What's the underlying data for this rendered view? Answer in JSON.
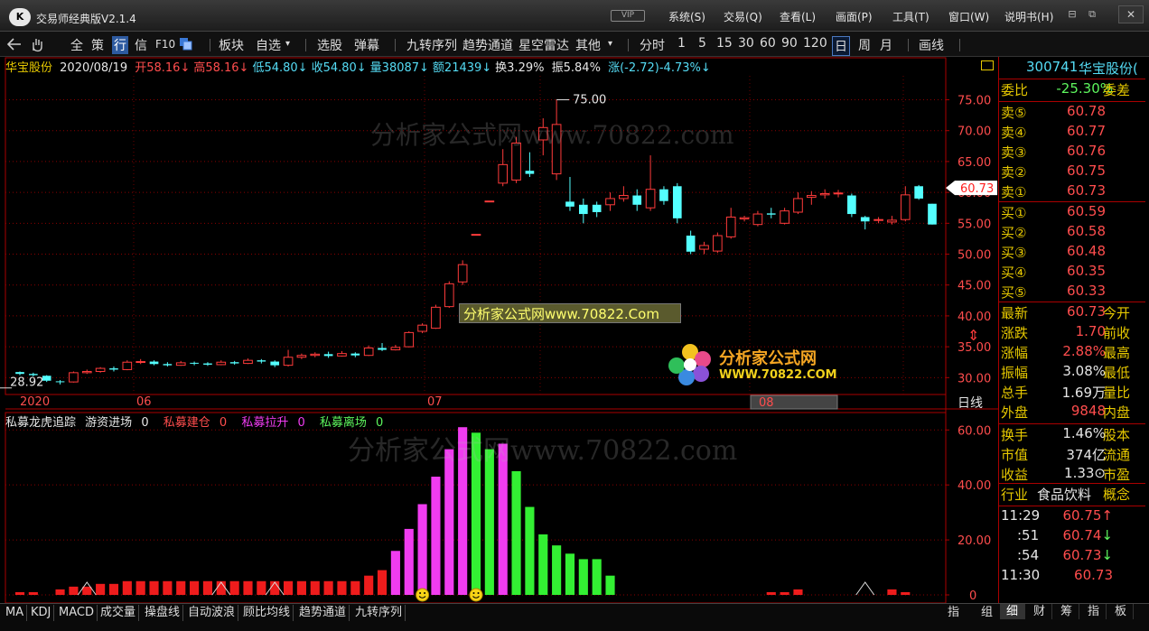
{
  "app": {
    "logo": "K",
    "title": "交易师经典版V2.1.4",
    "vip": "VIP"
  },
  "menu": [
    "系统(S)",
    "交易(Q)",
    "查看(L)",
    "画面(P)",
    "工具(T)",
    "窗口(W)",
    "说明书(H)"
  ],
  "window_controls": {
    "restore": "⊟",
    "max": "⧉",
    "close": "✕"
  },
  "toolbar": {
    "icons": [
      "back-icon",
      "hand-icon"
    ],
    "items": [
      "全",
      "策",
      "行",
      "信",
      "F10",
      "板块",
      "自选",
      "选股",
      "弹幕",
      "九转序列",
      "趋势通道",
      "星空雷达",
      "其他",
      "分时",
      "1",
      "5",
      "15",
      "30",
      "60",
      "90",
      "120",
      "日",
      "周",
      "月",
      "画线"
    ],
    "active": "行",
    "selected_period": "日"
  },
  "info": {
    "name": "华宝股份",
    "date": "2020/08/19",
    "open": "开58.16↓",
    "high": "高58.16↓",
    "low": "低54.80↓",
    "close": "收54.80↓",
    "volume": "量38087↓",
    "amount": "额21439↓",
    "turnover": "换3.29%",
    "amplitude": "振5.84%",
    "change": "涨(-2.72)-4.73%↓"
  },
  "price_axis": {
    "ticks": [
      "75.00",
      "70.00",
      "65.00",
      "60.00",
      "55.00",
      "50.00",
      "45.00",
      "40.00",
      "35.00",
      "30.00"
    ],
    "current": "60.73"
  },
  "annotations": {
    "high_label": "75.00",
    "low_label": "28.92"
  },
  "time_axis": {
    "labels": [
      "2020",
      "06",
      "07",
      "08"
    ],
    "period_label": "日线"
  },
  "indicator": {
    "title": "私募龙虎追踪",
    "legend": [
      {
        "label": "游资进场",
        "value": "0",
        "color": "#e6e6e6"
      },
      {
        "label": "私募建仓",
        "value": "0",
        "color": "#ff3333"
      },
      {
        "label": "私募拉升",
        "value": "0",
        "color": "#f03cf0"
      },
      {
        "label": "私募离场",
        "value": "0",
        "color": "#5df55d"
      }
    ],
    "axis": [
      "60.00",
      "40.00",
      "20.00",
      "0"
    ]
  },
  "chart_data": [
    {
      "type": "candlestick",
      "title": "华宝股份 日线",
      "ylim": [
        28,
        78
      ],
      "x_labels": [
        "2020",
        "06",
        "07",
        "08"
      ],
      "candles": [
        [
          30.9,
          30.6,
          31.0,
          30.4
        ],
        [
          30.6,
          30.4,
          30.8,
          30.2
        ],
        [
          30.3,
          29.5,
          30.4,
          29.3
        ],
        [
          29.4,
          29.3,
          29.6,
          28.9
        ],
        [
          29.3,
          30.8,
          31.0,
          29.2
        ],
        [
          30.8,
          31.0,
          31.3,
          30.6
        ],
        [
          31.0,
          31.5,
          31.7,
          30.8
        ],
        [
          31.5,
          31.3,
          31.8,
          31.0
        ],
        [
          31.3,
          32.5,
          32.8,
          31.2
        ],
        [
          32.5,
          32.6,
          33.0,
          32.2
        ],
        [
          32.6,
          32.2,
          32.8,
          32.0
        ],
        [
          32.2,
          32.0,
          32.5,
          31.8
        ],
        [
          32.0,
          32.4,
          32.7,
          31.9
        ],
        [
          32.4,
          32.3,
          32.6,
          32.0
        ],
        [
          32.3,
          32.1,
          32.5,
          31.9
        ],
        [
          32.1,
          32.5,
          32.8,
          32.0
        ],
        [
          32.5,
          32.3,
          32.7,
          32.1
        ],
        [
          32.3,
          32.8,
          33.1,
          32.2
        ],
        [
          32.8,
          32.6,
          33.0,
          32.3
        ],
        [
          32.6,
          32.0,
          32.8,
          31.7
        ],
        [
          32.0,
          33.3,
          34.5,
          31.8
        ],
        [
          33.3,
          33.6,
          33.9,
          33.0
        ],
        [
          33.6,
          33.8,
          34.1,
          33.3
        ],
        [
          33.8,
          33.5,
          34.2,
          33.2
        ],
        [
          33.5,
          33.9,
          34.3,
          33.4
        ],
        [
          33.9,
          33.6,
          34.1,
          33.3
        ],
        [
          33.6,
          34.8,
          35.2,
          33.5
        ],
        [
          34.8,
          34.5,
          35.6,
          34.3
        ],
        [
          34.5,
          34.9,
          35.3,
          34.4
        ],
        [
          35.0,
          37.3,
          37.5,
          34.9
        ],
        [
          37.5,
          38.5,
          38.8,
          37.2
        ],
        [
          38.0,
          41.4,
          41.8,
          37.9
        ],
        [
          41.5,
          45.2,
          45.6,
          41.3
        ],
        [
          45.5,
          48.3,
          49.0,
          45.0
        ],
        [
          53.2,
          53.2,
          53.2,
          53.2
        ],
        [
          58.6,
          58.6,
          58.6,
          58.6
        ],
        [
          61.5,
          64.5,
          67.0,
          61.0
        ],
        [
          62.0,
          68.0,
          69.0,
          61.5
        ],
        [
          63.5,
          63.0,
          66.5,
          62.5
        ],
        [
          68.5,
          70.5,
          72.0,
          66.0
        ],
        [
          63.0,
          71.0,
          75.0,
          62.0
        ],
        [
          58.5,
          57.7,
          62.5,
          57.0
        ],
        [
          58.0,
          56.5,
          59.0,
          55.0
        ],
        [
          58.0,
          56.8,
          58.5,
          56.0
        ],
        [
          58.0,
          59.0,
          60.0,
          57.0
        ],
        [
          59.0,
          59.5,
          61.0,
          58.5
        ],
        [
          59.5,
          58.0,
          60.5,
          57.0
        ],
        [
          57.5,
          60.5,
          66.0,
          57.0
        ],
        [
          60.5,
          58.6,
          61.0,
          58.0
        ],
        [
          61.0,
          55.8,
          61.5,
          55.0
        ],
        [
          53.0,
          50.4,
          53.8,
          50.0
        ],
        [
          50.8,
          51.4,
          52.0,
          50.0
        ],
        [
          50.5,
          53.0,
          53.5,
          50.2
        ],
        [
          52.8,
          56.0,
          57.5,
          52.5
        ],
        [
          55.7,
          55.9,
          56.2,
          55.3
        ],
        [
          54.8,
          56.5,
          57.0,
          54.5
        ],
        [
          56.6,
          56.4,
          57.5,
          55.8
        ],
        [
          55.0,
          57.0,
          57.5,
          54.8
        ],
        [
          56.8,
          59.0,
          60.0,
          56.5
        ],
        [
          59.2,
          59.5,
          60.2,
          58.0
        ],
        [
          59.6,
          59.8,
          60.5,
          59.0
        ],
        [
          59.8,
          59.9,
          60.4,
          59.2
        ],
        [
          59.5,
          56.5,
          59.8,
          56.0
        ],
        [
          56.0,
          55.3,
          56.2,
          54.0
        ],
        [
          55.5,
          55.6,
          56.0,
          55.0
        ],
        [
          55.2,
          55.5,
          56.2,
          54.8
        ],
        [
          55.6,
          59.6,
          61.0,
          55.3
        ],
        [
          61.0,
          59.0,
          61.2,
          58.8
        ],
        [
          58.16,
          54.8,
          58.16,
          54.8
        ]
      ]
    },
    {
      "type": "bar",
      "title": "私募龙虎追踪",
      "ylim": [
        0,
        66
      ],
      "series": [
        {
          "name": "游资进场",
          "values": [
            0,
            0,
            0,
            0,
            0,
            0,
            0,
            0,
            0,
            0,
            0,
            0,
            0,
            0,
            0,
            0,
            0,
            0,
            0,
            0,
            0,
            0,
            0,
            0,
            0,
            0,
            0,
            0,
            0,
            0,
            0,
            0,
            0,
            0,
            0,
            0,
            0,
            0,
            0,
            0,
            0,
            0,
            0,
            0,
            0,
            0,
            0,
            0,
            0,
            0,
            0,
            0,
            0,
            0,
            0,
            0,
            0,
            0,
            0,
            0,
            0,
            0,
            0,
            0,
            0,
            0,
            0,
            0
          ]
        },
        {
          "name": "私募建仓",
          "values": [
            1,
            1,
            0,
            2,
            3,
            3,
            4,
            4,
            5,
            5,
            5,
            5,
            5,
            5,
            5,
            5,
            5,
            5,
            5,
            5,
            5,
            5,
            5,
            5,
            5,
            5,
            7,
            9,
            0,
            0,
            0,
            0,
            0,
            0,
            0,
            0,
            0,
            0,
            0,
            0,
            0,
            0,
            0,
            0,
            0,
            0,
            0,
            0,
            0,
            0,
            0,
            0,
            0,
            0,
            0,
            0,
            1,
            1,
            2,
            0,
            0,
            0,
            0,
            0,
            0,
            2,
            1,
            0
          ]
        },
        {
          "name": "私募拉升",
          "values": [
            0,
            0,
            0,
            0,
            0,
            0,
            0,
            0,
            0,
            0,
            0,
            0,
            0,
            0,
            0,
            0,
            0,
            0,
            0,
            0,
            0,
            0,
            0,
            0,
            0,
            0,
            0,
            0,
            16,
            24,
            33,
            43,
            53,
            61,
            0,
            0,
            55,
            0,
            0,
            0,
            0,
            0,
            0,
            0,
            0,
            0,
            0,
            0,
            0,
            0,
            0,
            0,
            0,
            0,
            0,
            0,
            0,
            0,
            0,
            0,
            0,
            0,
            0,
            0,
            0,
            0,
            0,
            0
          ]
        },
        {
          "name": "私募离场",
          "values": [
            0,
            0,
            0,
            0,
            0,
            0,
            0,
            0,
            0,
            0,
            0,
            0,
            0,
            0,
            0,
            0,
            0,
            0,
            0,
            0,
            0,
            0,
            0,
            0,
            0,
            0,
            0,
            0,
            0,
            0,
            0,
            0,
            0,
            0,
            59,
            53,
            0,
            45,
            32,
            22,
            18,
            15,
            13,
            13,
            7,
            0,
            0,
            0,
            0,
            0,
            0,
            0,
            0,
            0,
            0,
            0,
            0,
            0,
            0,
            0,
            0,
            0,
            0,
            0,
            0,
            0,
            0,
            0
          ]
        }
      ]
    }
  ],
  "bottom_tabs": [
    "MA",
    "KDJ",
    "MACD",
    "成交量",
    "操盘线",
    "自动波浪",
    "顾比均线",
    "趋势通道",
    "九转序列"
  ],
  "bottom_right": [
    "指",
    "组"
  ],
  "side": {
    "code": "300741",
    "name": "华宝股份(",
    "weibi": {
      "k": "委比",
      "v": "-25.30%",
      "k2": "委差"
    },
    "sell": [
      {
        "k": "卖⑤",
        "v": "60.78"
      },
      {
        "k": "卖④",
        "v": "60.77"
      },
      {
        "k": "卖③",
        "v": "60.76"
      },
      {
        "k": "卖②",
        "v": "60.75"
      },
      {
        "k": "卖①",
        "v": "60.73"
      }
    ],
    "buy": [
      {
        "k": "买①",
        "v": "60.59"
      },
      {
        "k": "买②",
        "v": "60.58"
      },
      {
        "k": "买③",
        "v": "60.48"
      },
      {
        "k": "买④",
        "v": "60.35"
      },
      {
        "k": "买⑤",
        "v": "60.33"
      }
    ],
    "quote1": [
      {
        "k": "最新",
        "v": "60.73",
        "k2": "今开",
        "c": "red"
      },
      {
        "k": "涨跌",
        "v": "1.70",
        "k2": "前收",
        "c": "red"
      },
      {
        "k": "涨幅",
        "v": "2.88%",
        "k2": "最高",
        "c": "red"
      },
      {
        "k": "振幅",
        "v": "3.08%",
        "k2": "最低",
        "c": "white"
      },
      {
        "k": "总手",
        "v": "1.69万",
        "k2": "量比",
        "c": "white"
      },
      {
        "k": "外盘",
        "v": "9848",
        "k2": "内盘",
        "c": "red"
      }
    ],
    "quote2": [
      {
        "k": "换手",
        "v": "1.46%",
        "k2": "股本",
        "c": "white"
      },
      {
        "k": "市值",
        "v": "374亿",
        "k2": "流通",
        "c": "white"
      },
      {
        "k": "收益",
        "v": "1.33⊙",
        "k2": "市盈",
        "c": "white"
      }
    ],
    "industry": {
      "k": "行业",
      "v": "食品饮料",
      "k2": "概念"
    },
    "ticks": [
      {
        "t": "11:29",
        "p": "60.75↑",
        "c": "red"
      },
      {
        "t": ":51",
        "p": "60.74↓",
        "c": "red"
      },
      {
        "t": ":54",
        "p": "60.73↓",
        "c": "red"
      },
      {
        "t": "11:30",
        "p": "60.73",
        "c": "red"
      }
    ],
    "tabs": [
      "细",
      "财",
      "筹",
      "指",
      "板"
    ]
  },
  "watermarks": [
    "分析家公式网www.70822.com",
    "分析家公式网www.70822.com"
  ],
  "promo": {
    "text": "分析家公式网www.70822.Com",
    "brand": "分析家公式网",
    "url": "WWW.70822.COM"
  }
}
